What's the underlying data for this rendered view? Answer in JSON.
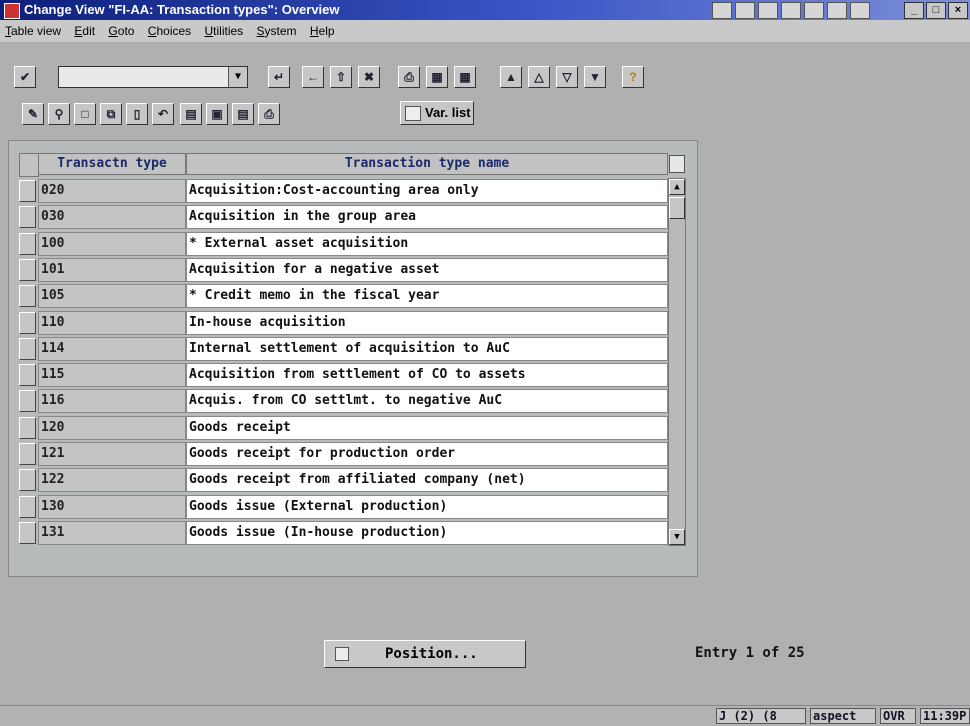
{
  "window": {
    "title": "Change View \"FI-AA: Transaction types\": Overview"
  },
  "menu": [
    "Table view",
    "Edit",
    "Goto",
    "Choices",
    "Utilities",
    "System",
    "Help"
  ],
  "toolbar": {
    "command_field_value": "",
    "var_list_label": "Var. list"
  },
  "table": {
    "columns": [
      "Transactn type",
      "Transaction type name"
    ],
    "rows": [
      {
        "code": "020",
        "name": "Acquisition:Cost-accounting area only"
      },
      {
        "code": "030",
        "name": "Acquisition in the group area"
      },
      {
        "code": "100",
        "name": "* External asset acquisition"
      },
      {
        "code": "101",
        "name": "Acquisition for a negative asset"
      },
      {
        "code": "105",
        "name": "* Credit memo in the fiscal year"
      },
      {
        "code": "110",
        "name": "In-house acquisition"
      },
      {
        "code": "114",
        "name": "Internal settlement of acquisition to AuC"
      },
      {
        "code": "115",
        "name": "Acquisition from settlement of CO to assets"
      },
      {
        "code": "116",
        "name": "Acquis. from CO settlmt. to negative AuC"
      },
      {
        "code": "120",
        "name": "Goods receipt"
      },
      {
        "code": "121",
        "name": "Goods receipt for production order"
      },
      {
        "code": "122",
        "name": "Goods receipt from affiliated company (net)"
      },
      {
        "code": "130",
        "name": "Goods issue (External production)"
      },
      {
        "code": "131",
        "name": "Goods issue (In-house production)"
      }
    ]
  },
  "position_button": "Position...",
  "entry_text": "Entry 1 of 25",
  "status": {
    "session": "J (2) (8",
    "host": "aspect",
    "mode": "OVR",
    "time": "11:39P"
  }
}
